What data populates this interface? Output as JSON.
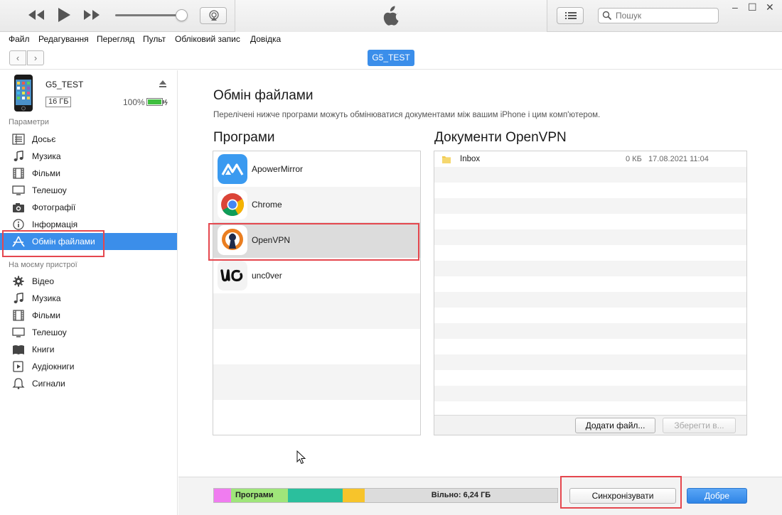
{
  "window": {
    "minimize": "–",
    "maximize": "☐",
    "close": "✕"
  },
  "player": {
    "prev_icon": "rewind-icon",
    "play_icon": "play-icon",
    "next_icon": "fast-forward-icon",
    "volume": 0.88
  },
  "search": {
    "placeholder": "Пошук"
  },
  "menu": [
    "Файл",
    "Редагування",
    "Перегляд",
    "Пульт",
    "Обліковий запис",
    "Довідка"
  ],
  "nav": {
    "back": "‹",
    "forward": "›",
    "device_name": "G5_TEST"
  },
  "device": {
    "name": "G5_TEST",
    "capacity": "16 ГБ",
    "battery": "100%"
  },
  "sidebar": {
    "section_settings": "Параметри",
    "settings_items": [
      {
        "label": "Досьє",
        "icon": "summary-icon"
      },
      {
        "label": "Музика",
        "icon": "music-icon"
      },
      {
        "label": "Фільми",
        "icon": "film-icon"
      },
      {
        "label": "Телешоу",
        "icon": "tv-icon"
      },
      {
        "label": "Фотографії",
        "icon": "camera-icon"
      },
      {
        "label": "Інформація",
        "icon": "info-icon"
      },
      {
        "label": "Обмін файлами",
        "icon": "apps-icon"
      }
    ],
    "section_device": "На моєму пристрої",
    "device_items": [
      {
        "label": "Відео",
        "icon": "gear-icon"
      },
      {
        "label": "Музика",
        "icon": "music-icon"
      },
      {
        "label": "Фільми",
        "icon": "film-icon"
      },
      {
        "label": "Телешоу",
        "icon": "tv-icon"
      },
      {
        "label": "Книги",
        "icon": "book-icon"
      },
      {
        "label": "Аудіокниги",
        "icon": "audiobook-icon"
      },
      {
        "label": "Сигнали",
        "icon": "bell-icon"
      }
    ]
  },
  "main": {
    "title": "Обмін файлами",
    "description": "Перелічені нижче програми можуть обмінюватися документами між вашим iPhone і цим комп'ютером.",
    "apps_header": "Програми",
    "apps": [
      {
        "name": "ApowerMirror"
      },
      {
        "name": "Chrome"
      },
      {
        "name": "OpenVPN"
      },
      {
        "name": "unc0ver"
      }
    ],
    "docs_header": "Документи OpenVPN",
    "documents": [
      {
        "name": "Inbox",
        "size": "0 КБ",
        "date": "17.08.2021 11:04"
      }
    ],
    "add_file": "Додати файл...",
    "save_to": "Зберегти в..."
  },
  "capacity_bar": {
    "apps_label": "Програми",
    "free_label": "Вільно: 6,24 ГБ"
  },
  "sync_label": "Синхронізувати",
  "done_label": "Добре",
  "colors": {
    "accent": "#3b8eea",
    "highlight_outline": "#e5474e",
    "seg_pink": "#f07cf0",
    "seg_apps": "#9fe57a",
    "seg_teal": "#2bbf9d",
    "seg_yellow": "#f7c42b"
  }
}
